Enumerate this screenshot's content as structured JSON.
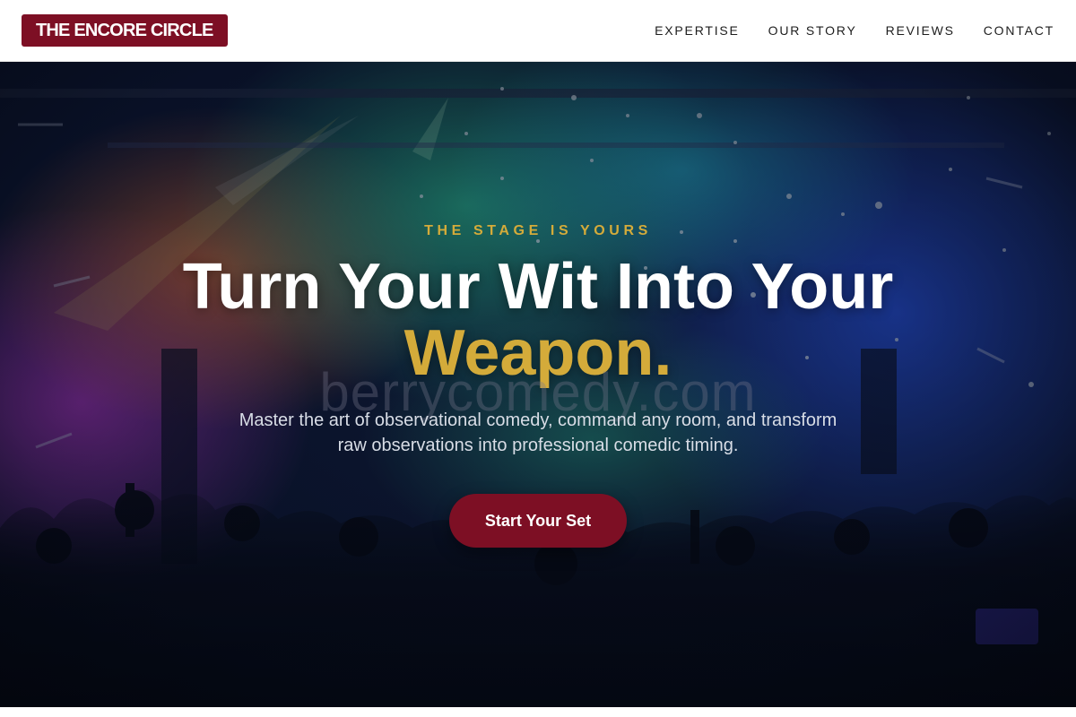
{
  "brand": {
    "logo_text": "THE ENCORE CIRCLE"
  },
  "nav": {
    "items": [
      {
        "label": "EXPERTISE"
      },
      {
        "label": "OUR STORY"
      },
      {
        "label": "REVIEWS"
      },
      {
        "label": "CONTACT"
      }
    ]
  },
  "hero": {
    "eyebrow": "THE STAGE IS YOURS",
    "headline_main": "Turn Your Wit Into Your",
    "headline_accent": "Weapon.",
    "watermark": "berrycomedy.com",
    "subtitle": "Master the art of observational comedy, command any room, and transform raw observations into professional comedic timing.",
    "cta_label": "Start Your Set"
  },
  "colors": {
    "brand": "#7d0f24",
    "accent_gold": "#d4ab3a",
    "header_bg": "#ffffff",
    "nav_text": "#1e1e1e"
  }
}
